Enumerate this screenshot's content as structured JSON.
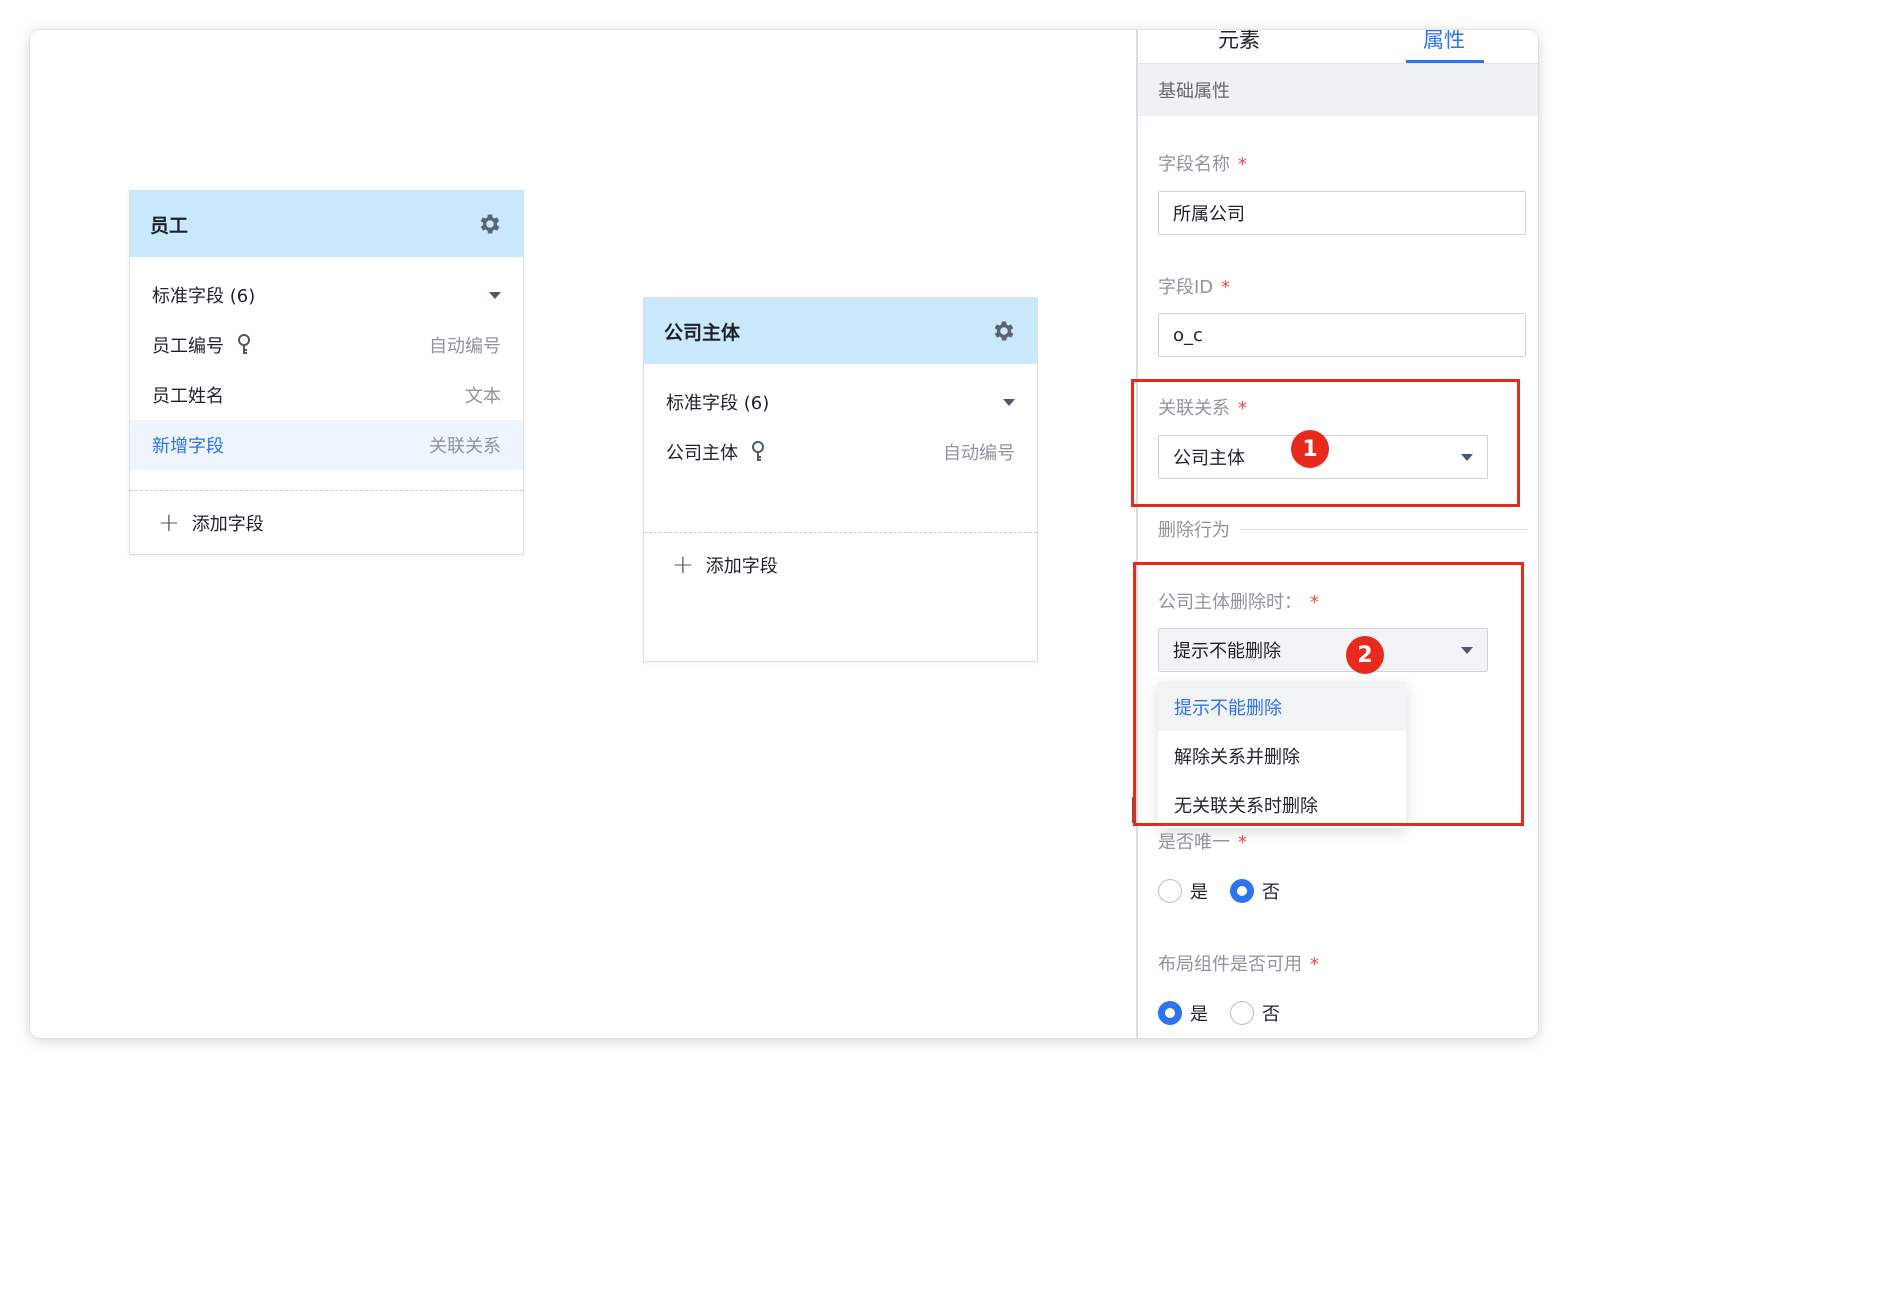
{
  "entities": [
    {
      "title": "员工",
      "group_label": "标准字段 (6)",
      "fields": [
        {
          "name": "员工编号",
          "type": "自动编号",
          "key": true,
          "highlight": false
        },
        {
          "name": "员工姓名",
          "type": "文本",
          "key": false,
          "highlight": false
        },
        {
          "name": "新增字段",
          "type": "关联关系",
          "key": false,
          "highlight": true
        }
      ],
      "add_label": "添加字段"
    },
    {
      "title": "公司主体",
      "group_label": "标准字段 (6)",
      "fields": [
        {
          "name": "公司主体",
          "type": "自动编号",
          "key": true,
          "highlight": false
        }
      ],
      "add_label": "添加字段"
    }
  ],
  "panel": {
    "tabs": [
      "元素",
      "属性"
    ],
    "active_tab": "属性",
    "section_title": "基础属性",
    "field_name_label": "字段名称",
    "field_name_value": "所属公司",
    "field_id_label": "字段ID",
    "field_id_value": "o_c",
    "relation_label": "关联关系",
    "relation_value": "公司主体",
    "delete_behavior_label": "删除行为",
    "on_delete_label": "公司主体删除时：",
    "on_delete_value": "提示不能删除",
    "on_delete_options": [
      "提示不能删除",
      "解除关系并删除",
      "无关联关系时删除"
    ],
    "unique_label": "是否唯一",
    "layout_label": "布局组件是否可用",
    "yes": "是",
    "no": "否",
    "required_mark": "*"
  },
  "annotations": {
    "badge1": "1",
    "badge2": "2",
    "color": "#e8291c"
  },
  "colors": {
    "accent": "#2e73f0",
    "card_header": "#c9e8fb"
  }
}
